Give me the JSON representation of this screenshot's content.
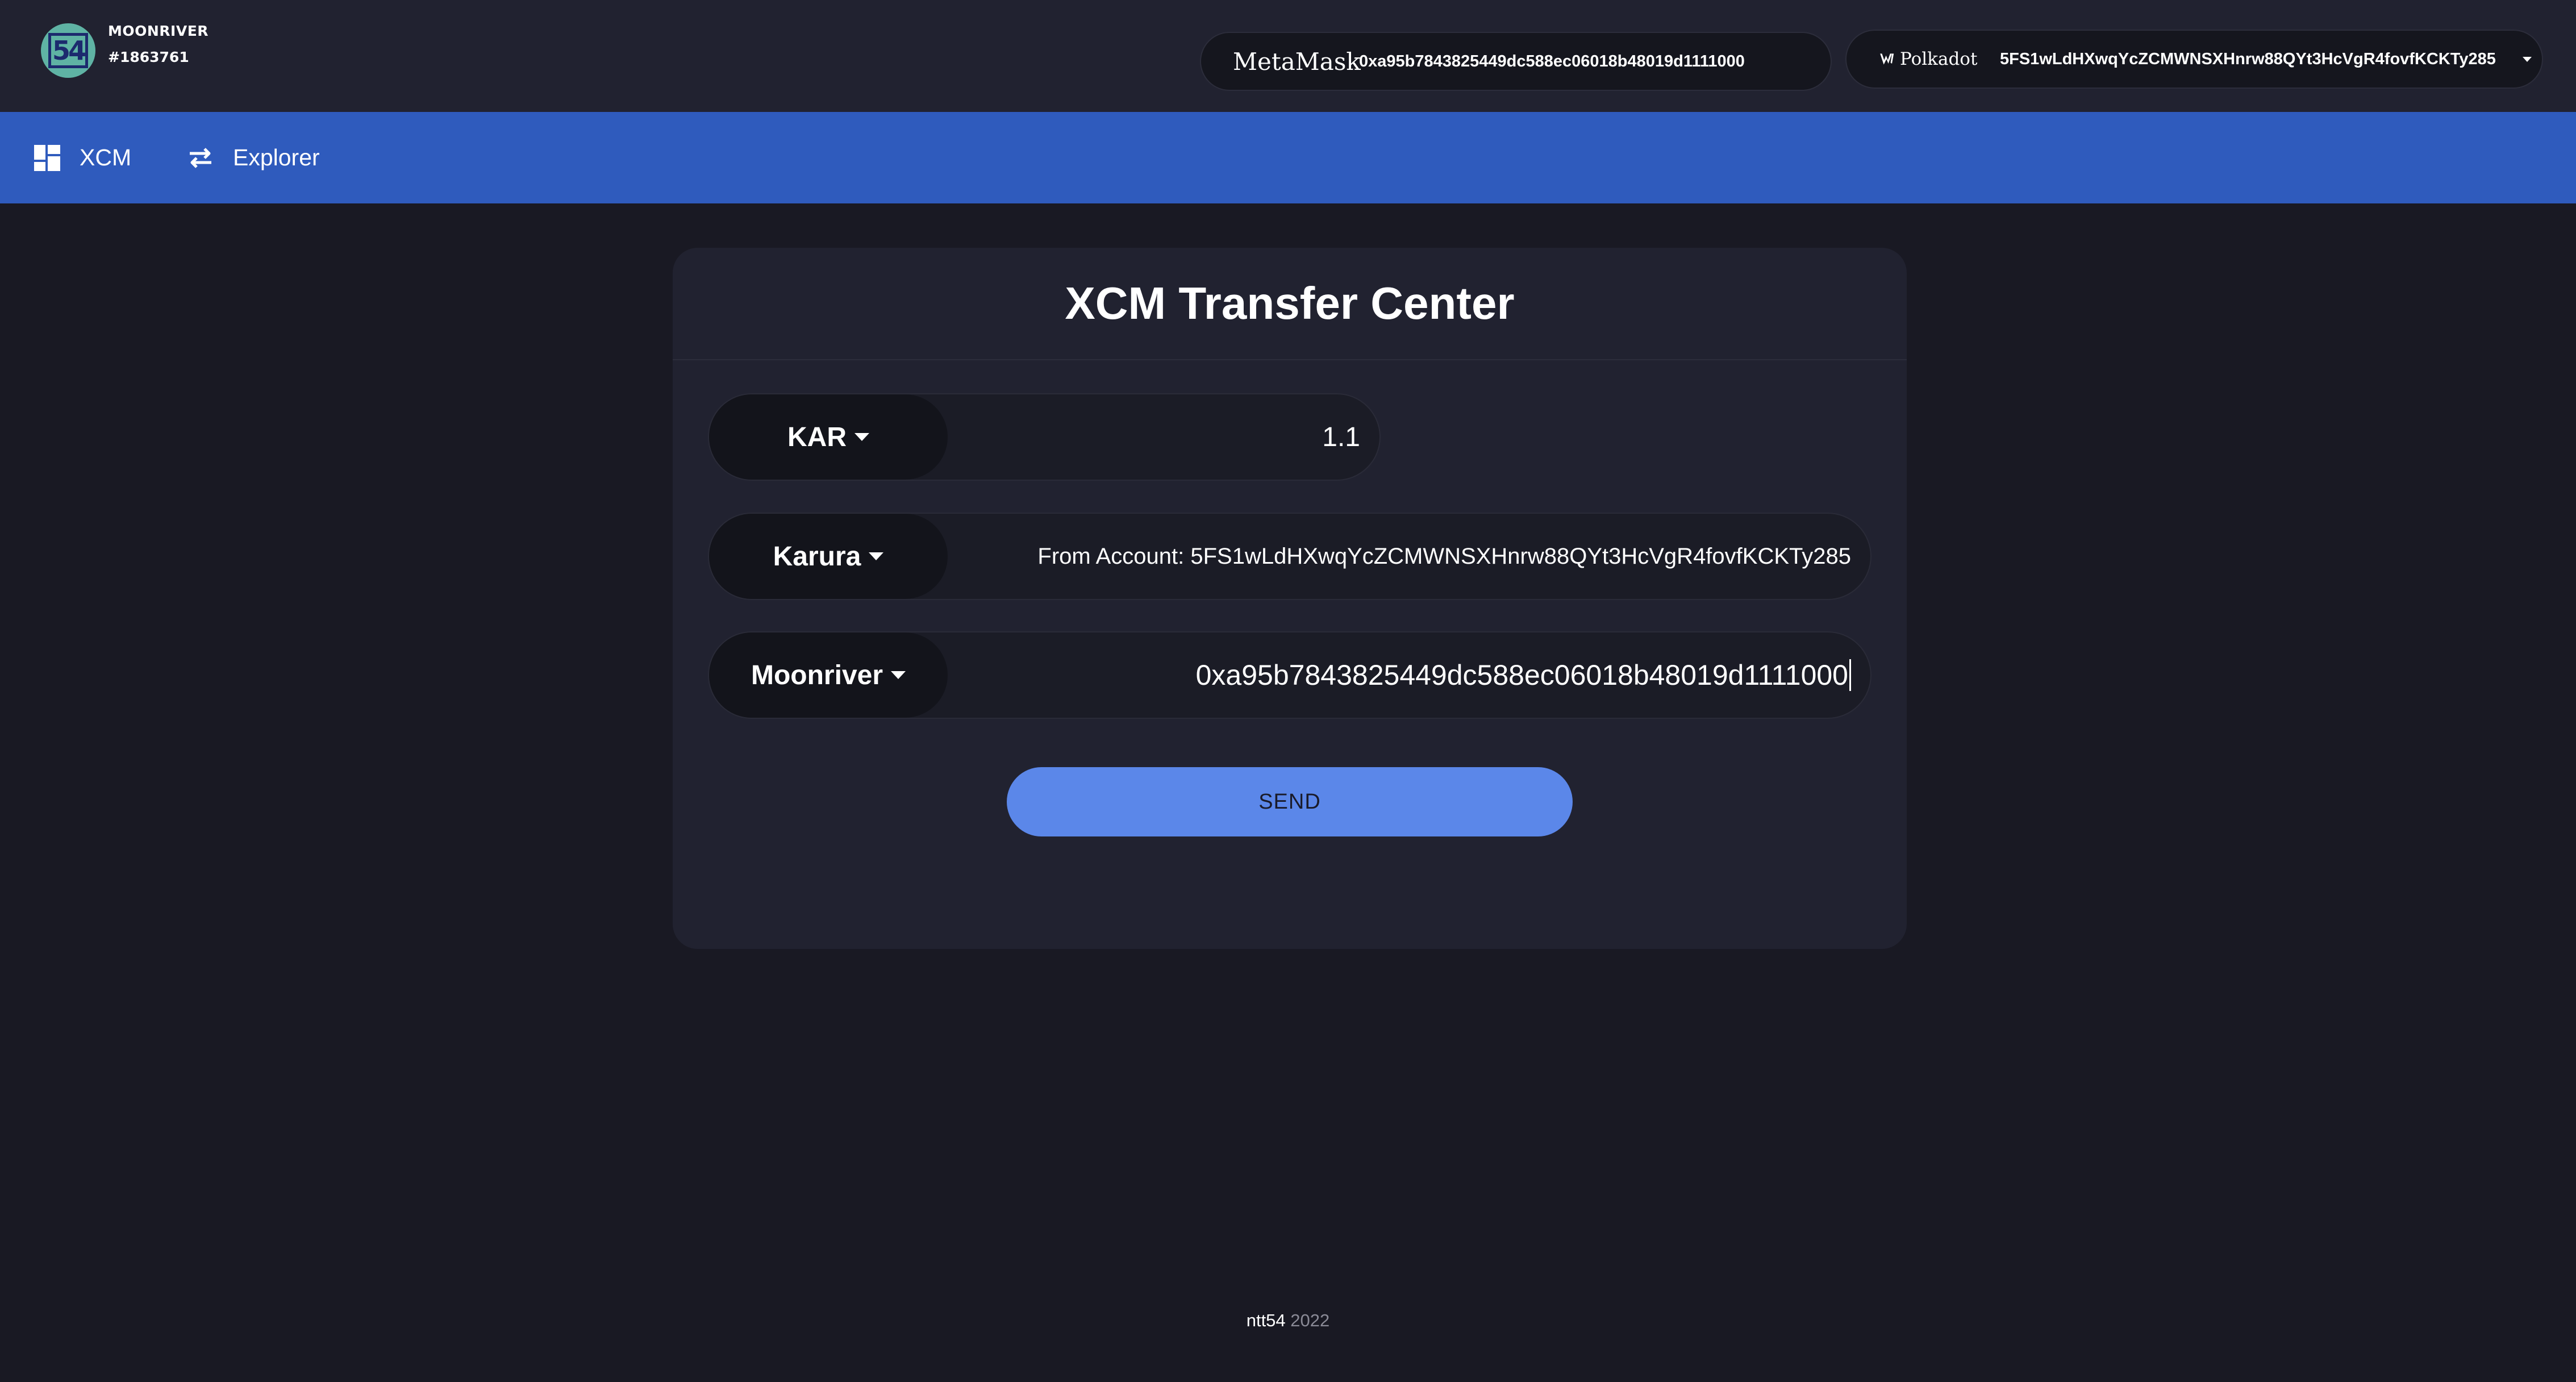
{
  "header": {
    "network_name": "MOONRIVER",
    "block_number": "#1863761",
    "logo_text": "54",
    "metamask": {
      "brand": "MetaMask",
      "address": "0xa95b7843825449dc588ec06018b48019d1111000"
    },
    "polkadot": {
      "brand": "Polkadot",
      "address": "5FS1wLdHXwqYcZCMWNSXHnrw88QYt3HcVgR4fovfKCKTy285"
    }
  },
  "nav": {
    "items": [
      {
        "label": "XCM",
        "icon": "grid-icon"
      },
      {
        "label": "Explorer",
        "icon": "swap-arrows-icon"
      }
    ]
  },
  "card": {
    "title": "XCM Transfer Center",
    "token": {
      "selected": "KAR",
      "amount": "1.1"
    },
    "source": {
      "selected": "Karura",
      "account_text": "From Account: 5FS1wLdHXwqYcZCMWNSXHnrw88QYt3HcVgR4fovfKCKTy285"
    },
    "destination": {
      "selected": "Moonriver",
      "address": "0xa95b7843825449dc588ec06018b48019d1111000"
    },
    "send_label": "SEND"
  },
  "footer": {
    "brand": "ntt54",
    "year": "2022"
  },
  "colors": {
    "background": "#191923",
    "header": "#212230",
    "nav": "#2f5bbd",
    "card": "#212230",
    "send_button": "#5b87e9"
  }
}
